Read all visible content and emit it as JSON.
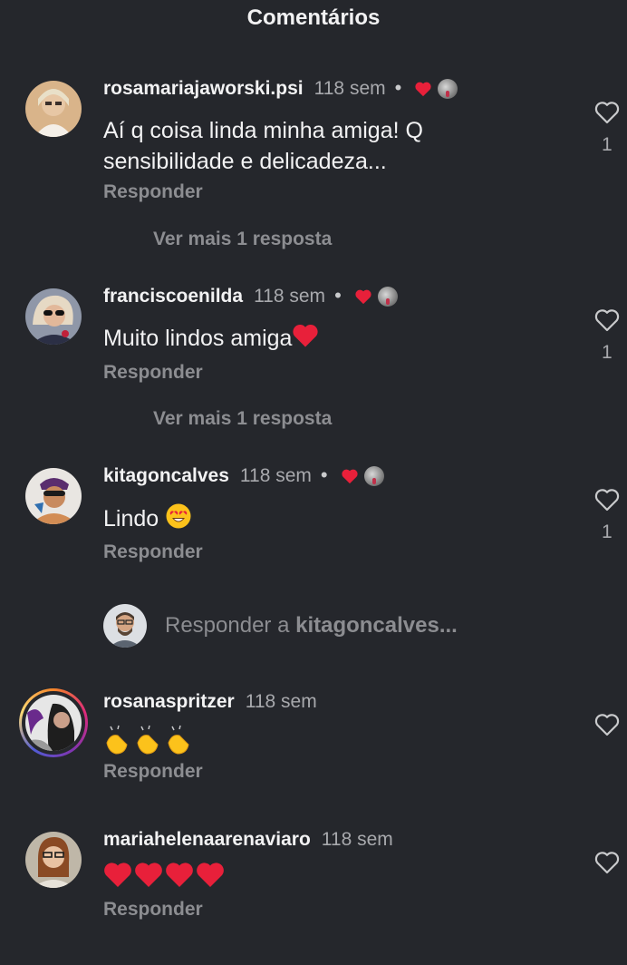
{
  "header": {
    "title": "Comentários"
  },
  "comments": [
    {
      "username": "rosamariajaworski.psi",
      "time": "118 sem",
      "dot": "•",
      "text": "Aí q coisa linda minha amiga! Q sensibilidade e delicadeza...",
      "reply_label": "Responder",
      "more_replies": "Ver mais 1 resposta",
      "like_count": "1",
      "author_liked": true
    },
    {
      "username": "franciscoenilda",
      "time": "118 sem",
      "dot": "•",
      "text": "Muito lindos amiga",
      "text_emoji": "red-heart",
      "reply_label": "Responder",
      "more_replies": "Ver mais 1 resposta",
      "like_count": "1",
      "author_liked": true
    },
    {
      "username": "kitagoncalves",
      "time": "118 sem",
      "dot": "•",
      "text": "Lindo",
      "text_emoji": "heart-eyes",
      "reply_label": "Responder",
      "like_count": "1",
      "author_liked": true
    },
    {
      "username": "rosanaspritzer",
      "time": "118 sem",
      "text_emoji": "clapping-hands x3",
      "reply_label": "Responder",
      "has_story_ring": true
    },
    {
      "username": "mariahelenaarenaviaro",
      "time": "118 sem",
      "text_emoji": "red-heart x4",
      "reply_label": "Responder"
    }
  ],
  "reply_input": {
    "prefix": "Responder a ",
    "target": "kitagoncalves..."
  },
  "colors": {
    "background": "#25272c",
    "text": "#f2f2f3",
    "muted": "#8c8d91",
    "heart": "#e8203a"
  }
}
